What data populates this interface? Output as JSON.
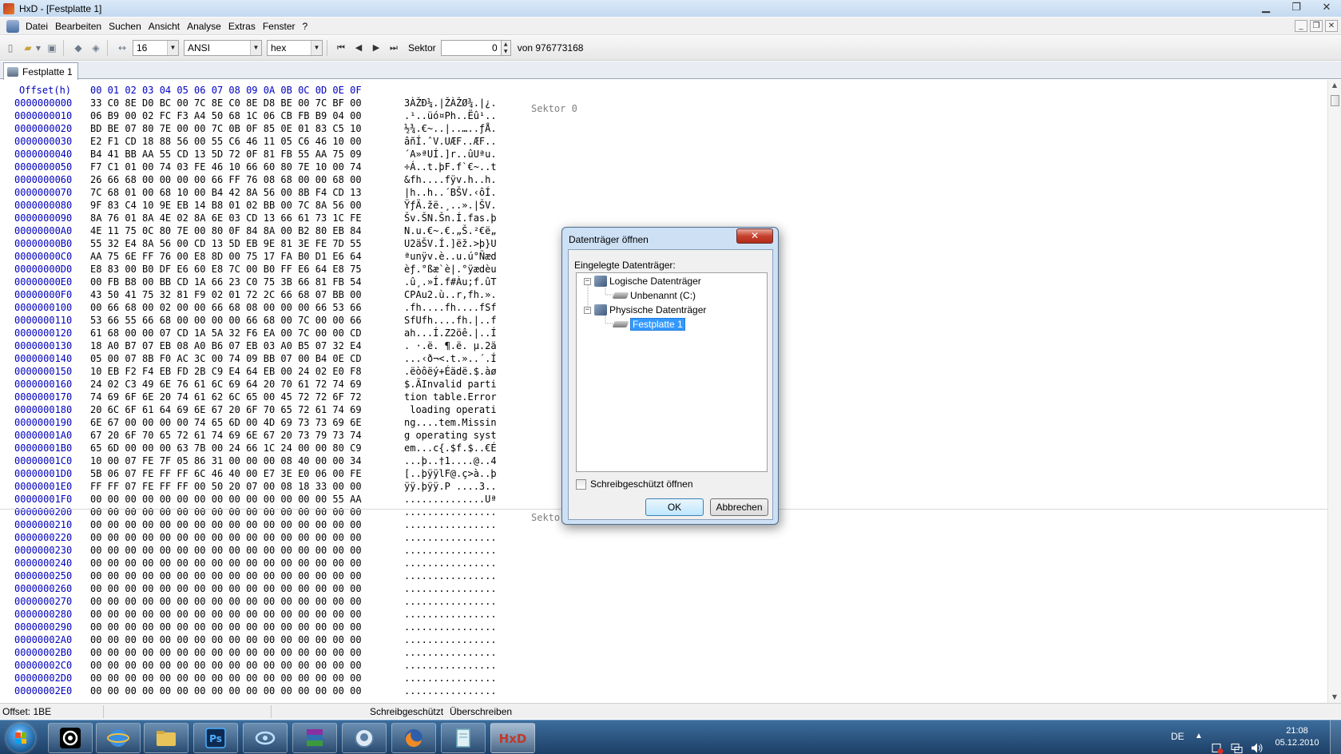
{
  "window": {
    "title": "HxD - [Festplatte 1]"
  },
  "menu": [
    "Datei",
    "Bearbeiten",
    "Suchen",
    "Ansicht",
    "Analyse",
    "Extras",
    "Fenster",
    "?"
  ],
  "toolbar": {
    "bytes_per_row": "16",
    "charset": "ANSI",
    "offset_base": "hex",
    "sector_label": "Sektor",
    "sector_value": "0",
    "sector_total": "von 976773168"
  },
  "tab": {
    "label": "Festplatte 1"
  },
  "hex": {
    "header_offset": "Offset(h)",
    "header_cols": "00 01 02 03 04 05 06 07 08 09 0A 0B 0C 0D 0E 0F",
    "rows": [
      {
        "offset": "0000000000",
        "hex": "33 C0 8E D0 BC 00 7C 8E C0 8E D8 BE 00 7C BF 00",
        "text": "3ÀŽÐ¼.|ŽÀŽØ¾.|¿."
      },
      {
        "offset": "0000000010",
        "hex": "06 B9 00 02 FC F3 A4 50 68 1C 06 CB FB B9 04 00",
        "text": ".¹..üó¤Ph..Ëû¹.."
      },
      {
        "offset": "0000000020",
        "hex": "BD BE 07 80 7E 00 00 7C 0B 0F 85 0E 01 83 C5 10",
        "text": "½¾.€~..|..…..ƒÅ."
      },
      {
        "offset": "0000000030",
        "hex": "E2 F1 CD 18 88 56 00 55 C6 46 11 05 C6 46 10 00",
        "text": "âñÍ.ˆV.UÆF..ÆF.."
      },
      {
        "offset": "0000000040",
        "hex": "B4 41 BB AA 55 CD 13 5D 72 0F 81 FB 55 AA 75 09",
        "text": "´A»ªUÍ.]r..ûUªu."
      },
      {
        "offset": "0000000050",
        "hex": "F7 C1 01 00 74 03 FE 46 10 66 60 80 7E 10 00 74",
        "text": "÷Á..t.þF.f`€~..t"
      },
      {
        "offset": "0000000060",
        "hex": "26 66 68 00 00 00 00 66 FF 76 08 68 00 00 68 00",
        "text": "&fh....fÿv.h..h."
      },
      {
        "offset": "0000000070",
        "hex": "7C 68 01 00 68 10 00 B4 42 8A 56 00 8B F4 CD 13",
        "text": "|h..h..´BŠV.‹ôÍ."
      },
      {
        "offset": "0000000080",
        "hex": "9F 83 C4 10 9E EB 14 B8 01 02 BB 00 7C 8A 56 00",
        "text": "ŸƒÄ.žë.¸..».|ŠV."
      },
      {
        "offset": "0000000090",
        "hex": "8A 76 01 8A 4E 02 8A 6E 03 CD 13 66 61 73 1C FE",
        "text": "Šv.ŠN.Šn.Í.fas.þ"
      },
      {
        "offset": "00000000A0",
        "hex": "4E 11 75 0C 80 7E 00 80 0F 84 8A 00 B2 80 EB 84",
        "text": "N.u.€~.€.„Š.²€ë„"
      },
      {
        "offset": "00000000B0",
        "hex": "55 32 E4 8A 56 00 CD 13 5D EB 9E 81 3E FE 7D 55",
        "text": "U2äŠV.Í.]ëž.>þ}U"
      },
      {
        "offset": "00000000C0",
        "hex": "AA 75 6E FF 76 00 E8 8D 00 75 17 FA B0 D1 E6 64",
        "text": "ªunÿv.è..u.ú°Ñæd"
      },
      {
        "offset": "00000000D0",
        "hex": "E8 83 00 B0 DF E6 60 E8 7C 00 B0 FF E6 64 E8 75",
        "text": "èƒ.°ßæ`è|.°ÿædèu"
      },
      {
        "offset": "00000000E0",
        "hex": "00 FB B8 00 BB CD 1A 66 23 C0 75 3B 66 81 FB 54",
        "text": ".û¸.»Í.f#Àu;f.ûT"
      },
      {
        "offset": "00000000F0",
        "hex": "43 50 41 75 32 81 F9 02 01 72 2C 66 68 07 BB 00",
        "text": "CPAu2.ù..r,fh.»."
      },
      {
        "offset": "0000000100",
        "hex": "00 66 68 00 02 00 00 66 68 08 00 00 00 66 53 66",
        "text": ".fh....fh....fSf"
      },
      {
        "offset": "0000000110",
        "hex": "53 66 55 66 68 00 00 00 00 66 68 00 7C 00 00 66",
        "text": "SfUfh....fh.|..f"
      },
      {
        "offset": "0000000120",
        "hex": "61 68 00 00 07 CD 1A 5A 32 F6 EA 00 7C 00 00 CD",
        "text": "ah...Í.Z2öê.|..Í"
      },
      {
        "offset": "0000000130",
        "hex": "18 A0 B7 07 EB 08 A0 B6 07 EB 03 A0 B5 07 32 E4",
        "text": ". ·.ë. ¶.ë. µ.2ä"
      },
      {
        "offset": "0000000140",
        "hex": "05 00 07 8B F0 AC 3C 00 74 09 BB 07 00 B4 0E CD",
        "text": "...‹ð¬<.t.»..´.Í"
      },
      {
        "offset": "0000000150",
        "hex": "10 EB F2 F4 EB FD 2B C9 E4 64 EB 00 24 02 E0 F8",
        "text": ".ëòôëý+Éädë.$.àø"
      },
      {
        "offset": "0000000160",
        "hex": "24 02 C3 49 6E 76 61 6C 69 64 20 70 61 72 74 69",
        "text": "$.ÃInvalid parti"
      },
      {
        "offset": "0000000170",
        "hex": "74 69 6F 6E 20 74 61 62 6C 65 00 45 72 72 6F 72",
        "text": "tion table.Error"
      },
      {
        "offset": "0000000180",
        "hex": "20 6C 6F 61 64 69 6E 67 20 6F 70 65 72 61 74 69",
        "text": " loading operati"
      },
      {
        "offset": "0000000190",
        "hex": "6E 67 00 00 00 00 74 65 6D 00 4D 69 73 73 69 6E",
        "text": "ng....tem.Missin"
      },
      {
        "offset": "00000001A0",
        "hex": "67 20 6F 70 65 72 61 74 69 6E 67 20 73 79 73 74",
        "text": "g operating syst"
      },
      {
        "offset": "00000001B0",
        "hex": "65 6D 00 00 00 63 7B 00 24 66 1C 24 00 00 80 C9",
        "text": "em...c{.$f.$..€É"
      },
      {
        "offset": "00000001C0",
        "hex": "10 00 07 FE 7F 05 86 31 00 00 00 08 40 00 00 34",
        "text": "...þ..†1....@..4"
      },
      {
        "offset": "00000001D0",
        "hex": "5B 06 07 FE FF FF 6C 46 40 00 E7 3E E0 06 00 FE",
        "text": "[..þÿÿlF@.ç>à..þ"
      },
      {
        "offset": "00000001E0",
        "hex": "FF FF 07 FE FF FF 00 50 20 07 00 08 18 33 00 00",
        "text": "ÿÿ.þÿÿ.P ....3.."
      },
      {
        "offset": "00000001F0",
        "hex": "00 00 00 00 00 00 00 00 00 00 00 00 00 00 55 AA",
        "text": "..............Uª"
      },
      {
        "offset": "0000000200",
        "hex": "00 00 00 00 00 00 00 00 00 00 00 00 00 00 00 00",
        "text": "................"
      },
      {
        "offset": "0000000210",
        "hex": "00 00 00 00 00 00 00 00 00 00 00 00 00 00 00 00",
        "text": "................"
      },
      {
        "offset": "0000000220",
        "hex": "00 00 00 00 00 00 00 00 00 00 00 00 00 00 00 00",
        "text": "................"
      },
      {
        "offset": "0000000230",
        "hex": "00 00 00 00 00 00 00 00 00 00 00 00 00 00 00 00",
        "text": "................"
      },
      {
        "offset": "0000000240",
        "hex": "00 00 00 00 00 00 00 00 00 00 00 00 00 00 00 00",
        "text": "................"
      },
      {
        "offset": "0000000250",
        "hex": "00 00 00 00 00 00 00 00 00 00 00 00 00 00 00 00",
        "text": "................"
      },
      {
        "offset": "0000000260",
        "hex": "00 00 00 00 00 00 00 00 00 00 00 00 00 00 00 00",
        "text": "................"
      },
      {
        "offset": "0000000270",
        "hex": "00 00 00 00 00 00 00 00 00 00 00 00 00 00 00 00",
        "text": "................"
      },
      {
        "offset": "0000000280",
        "hex": "00 00 00 00 00 00 00 00 00 00 00 00 00 00 00 00",
        "text": "................"
      },
      {
        "offset": "0000000290",
        "hex": "00 00 00 00 00 00 00 00 00 00 00 00 00 00 00 00",
        "text": "................"
      },
      {
        "offset": "00000002A0",
        "hex": "00 00 00 00 00 00 00 00 00 00 00 00 00 00 00 00",
        "text": "................"
      },
      {
        "offset": "00000002B0",
        "hex": "00 00 00 00 00 00 00 00 00 00 00 00 00 00 00 00",
        "text": "................"
      },
      {
        "offset": "00000002C0",
        "hex": "00 00 00 00 00 00 00 00 00 00 00 00 00 00 00 00",
        "text": "................"
      },
      {
        "offset": "00000002D0",
        "hex": "00 00 00 00 00 00 00 00 00 00 00 00 00 00 00 00",
        "text": "................"
      },
      {
        "offset": "00000002E0",
        "hex": "00 00 00 00 00 00 00 00 00 00 00 00 00 00 00 00",
        "text": "................"
      }
    ],
    "sector_marker_0": "Sektor 0",
    "sector_marker_1": "Sekto"
  },
  "status": {
    "offset": "Offset: 1BE",
    "mode_readonly": "Schreibgeschützt",
    "mode_overwrite": "Überschreiben"
  },
  "taskbar": {
    "apps": [
      "start-menu",
      "steam",
      "ie",
      "explorer",
      "photoshop",
      "eye-app",
      "winrar",
      "chat",
      "firefox",
      "notepad",
      "hxd"
    ],
    "language": "DE",
    "time": "21:08",
    "date": "05.12.2010"
  },
  "dialog": {
    "title": "Datenträger öffnen",
    "close_glyph": "✕",
    "section_label": "Eingelegte Datenträger:",
    "tree": {
      "logical_label": "Logische Datenträger",
      "logical_child": "Unbenannt (C:)",
      "physical_label": "Physische Datenträger",
      "physical_child": "Festplatte 1"
    },
    "readonly_label": "Schreibgeschützt öffnen",
    "ok_label": "OK",
    "cancel_label": "Abbrechen"
  },
  "colors": {
    "offset_blue": "#0000c0",
    "selection": "#3399ff",
    "taskbar": "#1d3f66"
  }
}
